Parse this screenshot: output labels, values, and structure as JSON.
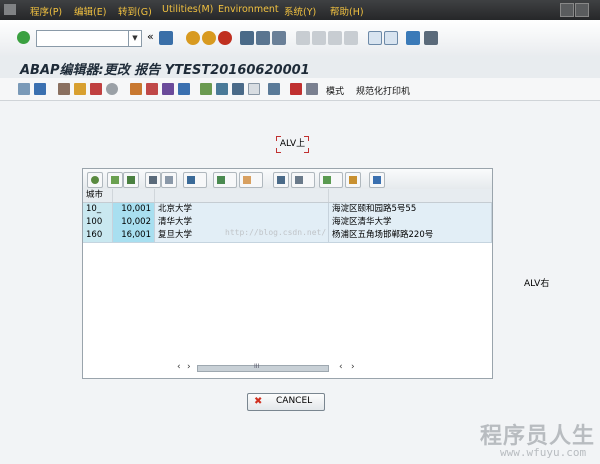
{
  "menubar": {
    "items": [
      "程序(P)",
      "编辑(E)",
      "转到(G)",
      "Utilities(M)",
      "Environment",
      "系统(Y)",
      "帮助(H)"
    ]
  },
  "toolbar": {
    "command_value": "",
    "back_label": "«"
  },
  "title": "ABAP编辑器:更改 报告 YTEST20160620001",
  "app_toolbar": {
    "mode_label": "模式",
    "print_label": "规范化打印机"
  },
  "alv_top_label": "ALV上",
  "alv_right_label": "ALV右",
  "grid": {
    "column_header": "城市",
    "rows": [
      {
        "city": "10_",
        "num": "10,001",
        "name": "北京大学",
        "addr": "海淀区颐和园路5号55"
      },
      {
        "city": "100",
        "num": "10,002",
        "name": "清华大学",
        "addr": "海淀区清华大学"
      },
      {
        "city": "160",
        "num": "16,001",
        "name": "复旦大学",
        "addr": "杨浦区五角场邯郸路220号"
      }
    ],
    "scroll_left": "‹",
    "scroll_right": "›",
    "scroll_label": "III"
  },
  "cancel_label": "CANCEL",
  "watermark": "http://blog.csdn.net/",
  "brand": "程序员人生",
  "brand_url": "www.wfuyu.com",
  "colors": {
    "menubar": "#2e3032",
    "menu_text": "#f0c040",
    "key_cell": "#a8dff0"
  }
}
